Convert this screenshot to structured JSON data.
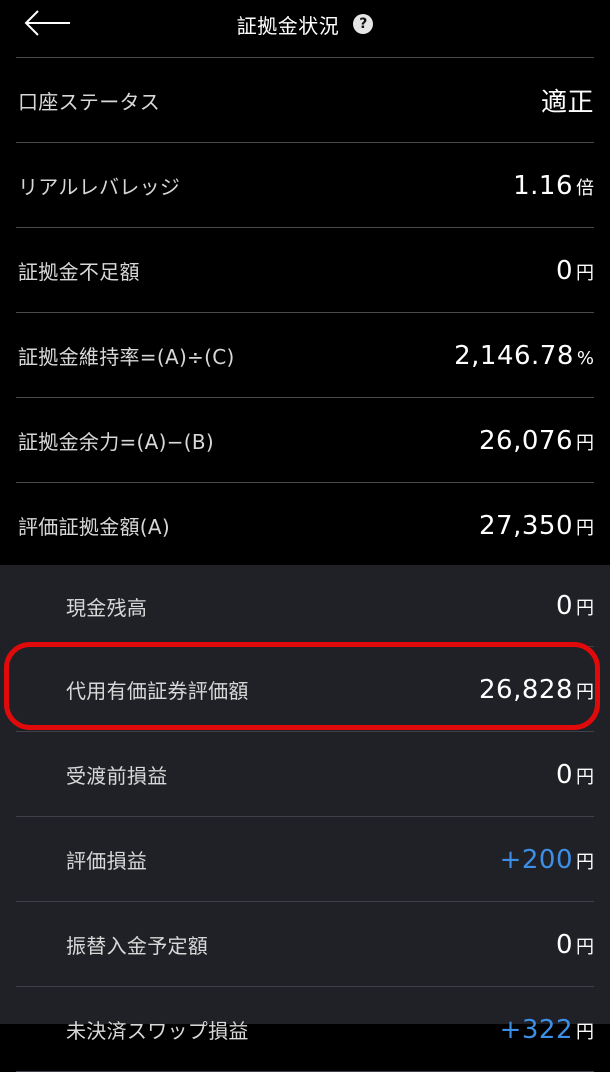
{
  "header": {
    "title": "証拠金状況",
    "help_icon": "?"
  },
  "rows": [
    {
      "label": "口座ステータス",
      "value": "適正",
      "unit": ""
    },
    {
      "label": "リアルレバレッジ",
      "value": "1.16",
      "unit": "倍"
    },
    {
      "label": "証拠金不足額",
      "value": "0",
      "unit": "円"
    },
    {
      "label": "証拠金維持率=(A)÷(C)",
      "value": "2,146.78",
      "unit": "%"
    },
    {
      "label": "証拠金余力=(A)−(B)",
      "value": "26,076",
      "unit": "円"
    },
    {
      "label": "評価証拠金額(A)",
      "value": "27,350",
      "unit": "円"
    }
  ],
  "sub_rows": [
    {
      "label": "現金残高",
      "value": "0",
      "unit": "円"
    },
    {
      "label": "代用有価証券評価額",
      "value": "26,828",
      "unit": "円"
    },
    {
      "label": "受渡前損益",
      "value": "0",
      "unit": "円"
    },
    {
      "label": "評価損益",
      "value": "+200",
      "unit": "円"
    },
    {
      "label": "振替入金予定額",
      "value": "0",
      "unit": "円"
    },
    {
      "label": "未決済スワップ損益",
      "value": "+322",
      "unit": "円"
    }
  ],
  "colors": {
    "background": "#000000",
    "sub_background": "#1f2126",
    "positive": "#3d8ee6",
    "highlight": "#e10a0a"
  }
}
